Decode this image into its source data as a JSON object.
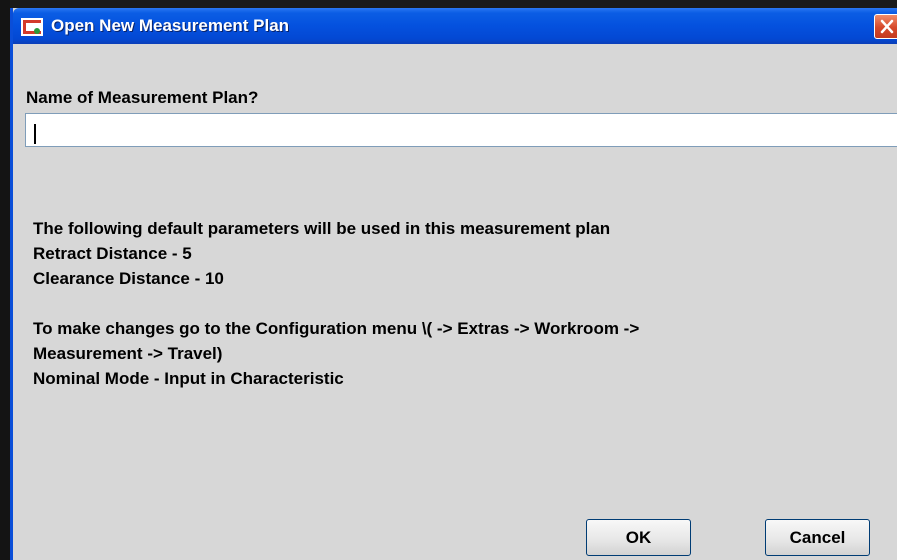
{
  "window": {
    "title": "Open New Measurement Plan",
    "icon": "application-icon",
    "close_icon": "close-icon"
  },
  "form": {
    "prompt_label": "Name of Measurement Plan?",
    "name_value": "",
    "name_placeholder": ""
  },
  "info": {
    "lines": [
      "The following default parameters will be used in this measurement plan",
      "Retract Distance - 5",
      "Clearance Distance - 10",
      "To make changes go to the Configuration menu \\( -> Extras -> Workroom ->",
      "Measurement -> Travel)",
      "Nominal Mode - Input in Characteristic"
    ]
  },
  "buttons": {
    "ok_label": "OK",
    "cancel_label": "Cancel"
  },
  "colors": {
    "titlebar": "#0451de",
    "dialog_background": "#d7d7d7",
    "close_button": "#d6482a"
  }
}
